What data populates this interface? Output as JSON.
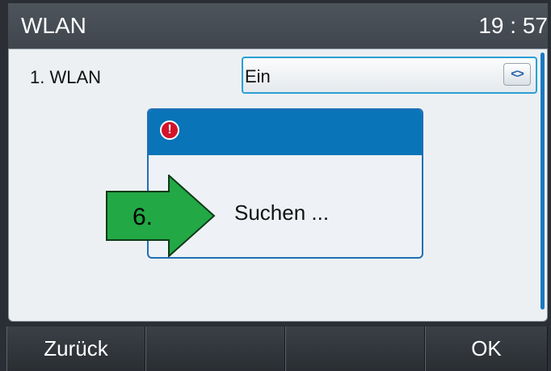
{
  "header": {
    "title": "WLAN",
    "clock": "19 : 57"
  },
  "settings": {
    "row_label": "1.  WLAN",
    "select_value": "Ein",
    "select_arrows": "<>"
  },
  "dialog": {
    "message": "Suchen ..."
  },
  "annotation": {
    "step_label": "6.",
    "arrow_color": "#22a845"
  },
  "softkeys": [
    "Zurück",
    "",
    "",
    "OK"
  ],
  "colors": {
    "accent": "#0a74b8",
    "focus_border": "#2aa0d6",
    "alert": "#d3132a"
  },
  "icons": {
    "dialog_icon": "alert-icon",
    "select_icon": "chevron-left-right-icon"
  }
}
